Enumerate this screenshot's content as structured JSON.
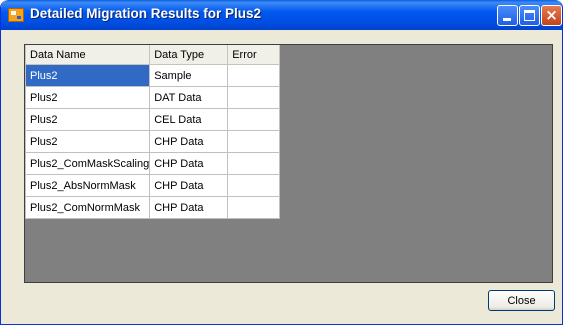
{
  "window": {
    "title": "Detailed Migration Results for Plus2",
    "buttons": {
      "minimize": "minimize",
      "maximize": "maximize",
      "close": "×"
    }
  },
  "table": {
    "columns": [
      "Data Name",
      "Data Type",
      "Error"
    ],
    "selected_row": 0,
    "rows": [
      [
        "Plus2",
        "Sample",
        ""
      ],
      [
        "Plus2",
        "DAT Data",
        ""
      ],
      [
        "Plus2",
        "CEL Data",
        ""
      ],
      [
        "Plus2",
        "CHP Data",
        ""
      ],
      [
        "Plus2_ComMaskScaling",
        "CHP Data",
        ""
      ],
      [
        "Plus2_AbsNormMask",
        "CHP Data",
        ""
      ],
      [
        "Plus2_ComNormMask",
        "CHP Data",
        ""
      ]
    ]
  },
  "footer": {
    "close_label": "Close"
  },
  "colors": {
    "titlebar": "#0058ee",
    "selection": "#316ac5",
    "grid_background": "#808080",
    "window_face": "#ece9d8"
  }
}
